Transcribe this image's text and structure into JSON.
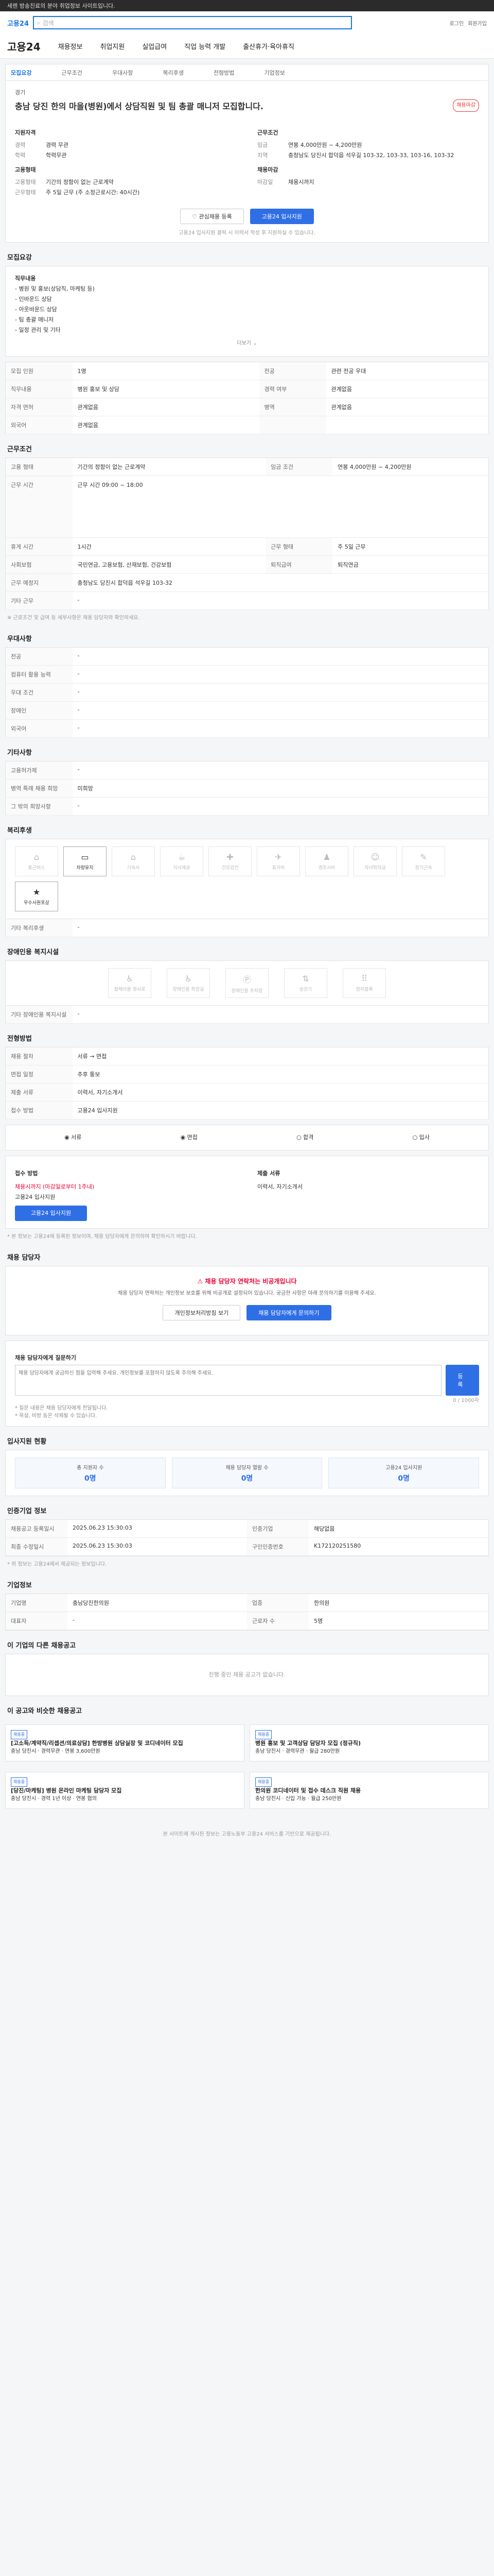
{
  "topbar": {
    "text": "세렌 방송진료의 분야 취업정보 사이트입니다."
  },
  "search": {
    "logo": "고용24",
    "placeholder": "검색",
    "right_links": [
      "로그인",
      "회원가입"
    ]
  },
  "nav": {
    "brand": "고용24",
    "items": [
      "채용정보",
      "취업지원",
      "실업급여",
      "직업 능력 개발",
      "출산휴가·육아휴직"
    ]
  },
  "tabs": [
    "모집요강",
    "근무조건",
    "우대사항",
    "복리후생",
    "전형방법",
    "기업정보"
  ],
  "header": {
    "company": "경기",
    "title": "충남 당진 한의 마을(병원)에서 상담직원 및 팀 총괄 매니저 모집합니다.",
    "badge": "채용마감",
    "left": {
      "heading": "지원자격",
      "rows": [
        {
          "k": "경력",
          "v": "경력 무관"
        },
        {
          "k": "학력",
          "v": "학력무관"
        }
      ],
      "heading2": "고용형태",
      "rows2": [
        {
          "k": "고용형태",
          "v": "기간의 정함이 없는 근로계약"
        },
        {
          "k": "근무형태",
          "v": "주 5일 근무 (주 소정근로시간: 40시간)"
        }
      ]
    },
    "right": {
      "heading": "근무조건",
      "rows": [
        {
          "k": "임금",
          "v": "연봉 4,000만원 ~ 4,200만원"
        },
        {
          "k": "지역",
          "v": "충청남도 당진시 합덕읍 석우길 103-32, 103-33, 103-16, 103-32"
        }
      ],
      "heading2": "채용마감",
      "rows2": [
        {
          "k": "마감일",
          "v": "채용시까지"
        }
      ]
    },
    "buttons": {
      "scrap": "관심채용 등록",
      "apply": "고용24 입사지원"
    },
    "note": "고용24 입사지원 클릭 시 이력서 작성 후 지원하실 수 있습니다."
  },
  "recruit": {
    "title": "모집요강",
    "lines": [
      "직무내용",
      "- 병원 및 홍보(상담직, 마케팅 등)",
      "- 인바운드 상담",
      "- 아웃바운드 상담",
      "- 팀 총괄 매니저",
      "- 일정 관리 및 기타"
    ],
    "more": "더보기"
  },
  "spec": {
    "rows": [
      [
        "모집 인원",
        "1명",
        "전공",
        "관련 전공 우대"
      ],
      [
        "직무내용",
        "병원 홍보 및 상담",
        "경력 여부",
        "관계없음"
      ],
      [
        "자격 면허",
        "관계없음",
        "병역",
        "관계없음"
      ],
      [
        "외국어",
        "관계없음",
        "",
        ""
      ]
    ]
  },
  "work": {
    "title": "근무조건",
    "rows": [
      [
        "고용 형태",
        "기간의 정함이 없는 근로계약",
        "임금 조건",
        "연봉 4,000만원 ~ 4,200만원"
      ],
      [
        "근무 시간",
        "근무 시간 09:00 ~ 18:00",
        "",
        ""
      ],
      [
        "휴게 시간",
        "1시간",
        "근무 형태",
        "주 5일 근무"
      ],
      [
        "사회보험",
        "국민연금, 고용보험, 산재보험, 건강보험",
        "퇴직급여",
        "퇴직연금"
      ],
      [
        "근무 예정지",
        "충청남도 당진시 합덕읍 석우길 103-32",
        "",
        ""
      ],
      [
        "기타 근무",
        "-",
        "",
        ""
      ]
    ],
    "note": "※ 근로조건 및 급여 등 세부사항은 채용 담당자와 확인하세요."
  },
  "pref": {
    "title": "우대사항",
    "rows": [
      [
        "전공",
        "-"
      ],
      [
        "컴퓨터 활용 능력",
        "-"
      ],
      [
        "우대 조건",
        "-"
      ],
      [
        "장애인",
        "-"
      ],
      [
        "외국어",
        "-"
      ]
    ]
  },
  "etc": {
    "title": "기타사항",
    "rows": [
      [
        "고용허가제",
        "-"
      ],
      [
        "병역 특례 채용 희망",
        "미희망"
      ],
      [
        "그 밖의 희망사항",
        "-"
      ]
    ]
  },
  "welfare": {
    "title": "복리후생",
    "items": [
      {
        "g": "⌂",
        "label": "통근버스",
        "on": false
      },
      {
        "g": "▭",
        "label": "차량유지",
        "on": true
      },
      {
        "g": "⌂",
        "label": "기숙사",
        "on": false
      },
      {
        "g": "☕",
        "label": "식사제공",
        "on": false
      },
      {
        "g": "✚",
        "label": "건강검진",
        "on": false
      },
      {
        "g": "✈",
        "label": "휴가비",
        "on": false
      },
      {
        "g": "♟",
        "label": "경조사비",
        "on": false
      },
      {
        "g": "☺",
        "label": "자녀학자금",
        "on": false
      },
      {
        "g": "✎",
        "label": "장기근속",
        "on": false
      },
      {
        "g": "★",
        "label": "우수사원포상",
        "on": true
      }
    ],
    "extra_label": "기타 복리후생",
    "extra_value": "-"
  },
  "disability": {
    "title": "장애인용 복지시설",
    "items": [
      "휠체어용 경사로",
      "장애인용 화장실",
      "장애인용 주차장",
      "승강기",
      "점자블록"
    ],
    "extra_label": "기타 장애인용 복지시설",
    "extra_value": "-"
  },
  "process": {
    "title": "전형방법",
    "rows": [
      [
        "채용 절차",
        "서류 → 면접"
      ],
      [
        "면접 일정",
        "추후 통보"
      ],
      [
        "제출 서류",
        "이력서, 자기소개서"
      ],
      [
        "접수 방법",
        "고용24 입사지원"
      ]
    ],
    "steps": [
      "서류",
      "면접",
      "합격",
      "입사"
    ]
  },
  "apply": {
    "left_head": "접수 방법",
    "left_lines": [
      "채용시까지 (마감일로부터 1주내)",
      "고용24 입사지원"
    ],
    "left_btn": "고용24 입사지원",
    "right_head": "제출 서류",
    "right_lines": [
      "이력서, 자기소개서"
    ],
    "notes": [
      "* 본 정보는 고용24에 등록된 정보이며, 채용 담당자에게 문의하여 확인하시기 바랍니다."
    ]
  },
  "manager": {
    "title": "채용 담당자",
    "alert": "채용 담당자 연락처는 비공개입니다",
    "desc": "채용 담당자 연락처는 개인정보 보호를 위해 비공개로 설정되어 있습니다. 궁금한 사항은 아래 문의하기를 이용해 주세요.",
    "buttons": [
      "개인정보처리방침 보기",
      "채용 담당자에게 문의하기"
    ]
  },
  "qa": {
    "title": "채용 담당자에게 질문하기",
    "placeholder": "채용 담당자에게 궁금하신 점을 입력해 주세요. 개인정보를 포함하지 않도록 주의해 주세요.",
    "submit": "등록",
    "counter": "0 / 1000자",
    "notes": [
      "* 질문 내용은 채용 담당자에게 전달됩니다.",
      "* 욕설, 비방 등은 삭제될 수 있습니다."
    ]
  },
  "stats": {
    "title": "입사지원 현황",
    "items": [
      {
        "label": "총 지원자 수",
        "value": "0명"
      },
      {
        "label": "채용 담당자 열람 수",
        "value": "0명"
      },
      {
        "label": "고용24 입사지원",
        "value": "0명"
      }
    ]
  },
  "info": {
    "title": "인증기업 정보",
    "rows": [
      [
        "채용공고 등록일시",
        "2025.06.23 15:30:03",
        "인증기업",
        "해당없음"
      ],
      [
        "최종 수정일시",
        "2025.06.23 15:30:03",
        "구인인증번호",
        "K172120251580"
      ]
    ],
    "note": "* 위 정보는 고용24에서 제공되는 정보입니다."
  },
  "company": {
    "title": "기업정보",
    "rows": [
      [
        "기업명",
        "충남당진한의원",
        "업종",
        "한의원"
      ],
      [
        "대표자",
        "-",
        "근로자 수",
        "5명"
      ]
    ]
  },
  "list": {
    "title": "이 기업의 다른 채용공고",
    "empty": "진행 중인 채용 공고가 없습니다."
  },
  "recommend": {
    "title": "이 공고와 비슷한 채용공고",
    "cards": [
      {
        "badge": "채용중",
        "t": "[고소득/계약직/리셉션/의료상담] 한방병원 상담실장 및 코디네이터 모집",
        "d": "충남 당진시 · 경력무관 · 연봉 3,600만원"
      },
      {
        "badge": "채용중",
        "t": "병원 홍보 및 고객상담 담당자 모집 (정규직)",
        "d": "충남 당진시 · 경력무관 · 월급 280만원"
      },
      {
        "badge": "채용중",
        "t": "[당진/마케팅] 병원 온라인 마케팅 담당자 모집",
        "d": "충남 당진시 · 경력 1년 이상 · 연봉 협의"
      },
      {
        "badge": "채용중",
        "t": "한의원 코디네이터 및 접수 데스크 직원 채용",
        "d": "충남 당진시 · 신입 가능 · 월급 250만원"
      }
    ]
  },
  "footer": {
    "text": "본 사이트에 게시된 정보는 고용노동부 고용24 서비스를 기반으로 제공됩니다."
  }
}
